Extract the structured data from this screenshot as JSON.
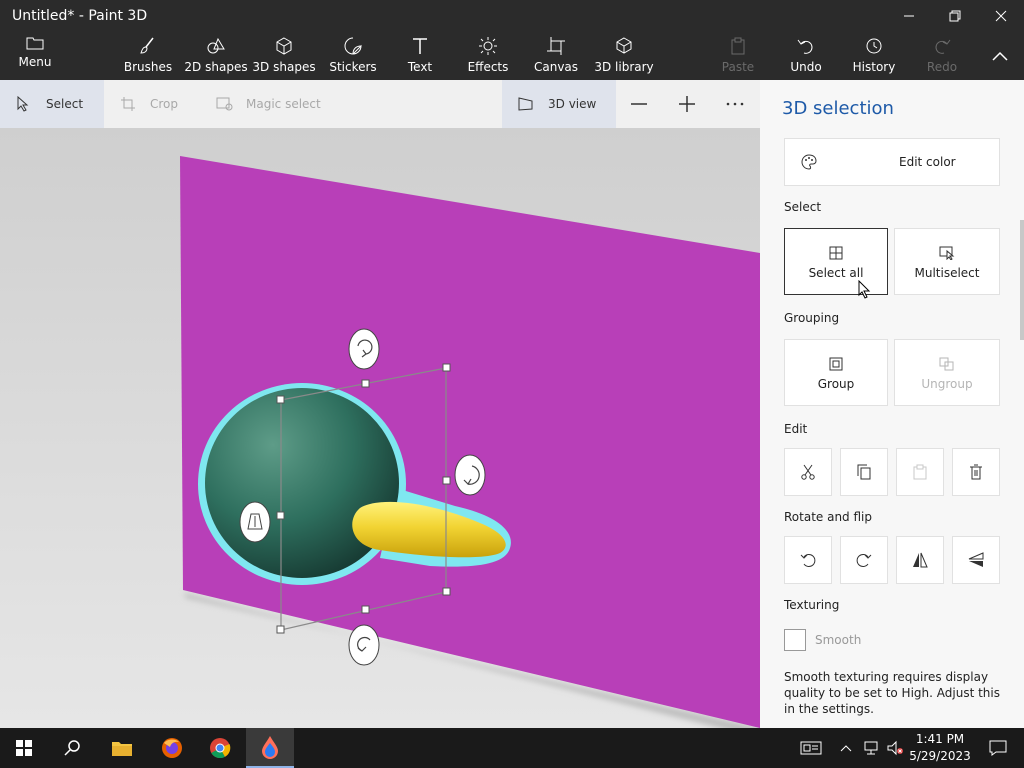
{
  "window": {
    "title": "Untitled* - Paint 3D"
  },
  "ribbon": {
    "menu": "Menu",
    "brushes": "Brushes",
    "shapes2d": "2D shapes",
    "shapes3d": "3D shapes",
    "stickers": "Stickers",
    "text": "Text",
    "effects": "Effects",
    "canvas": "Canvas",
    "library": "3D library",
    "paste": "Paste",
    "undo": "Undo",
    "history": "History",
    "redo": "Redo"
  },
  "toolbar": {
    "select": "Select",
    "crop": "Crop",
    "magic_select": "Magic select",
    "view3d": "3D view"
  },
  "panel": {
    "title": "3D selection",
    "edit_color": "Edit color",
    "select_header": "Select",
    "select_all": "Select all",
    "multiselect": "Multiselect",
    "grouping_header": "Grouping",
    "group": "Group",
    "ungroup": "Ungroup",
    "edit_header": "Edit",
    "rotate_header": "Rotate and flip",
    "texturing_header": "Texturing",
    "smooth": "Smooth",
    "smooth_note": "Smooth texturing requires display quality to be set to High. Adjust this in the settings.",
    "smooth_checked": false
  },
  "taskbar": {
    "time": "1:41 PM",
    "date": "5/29/2023"
  },
  "colors": {
    "plane": "#b83fb8",
    "sphere": "#2e6f5e",
    "cone": "#f2d433",
    "selection_outline": "#7fe7f0"
  }
}
